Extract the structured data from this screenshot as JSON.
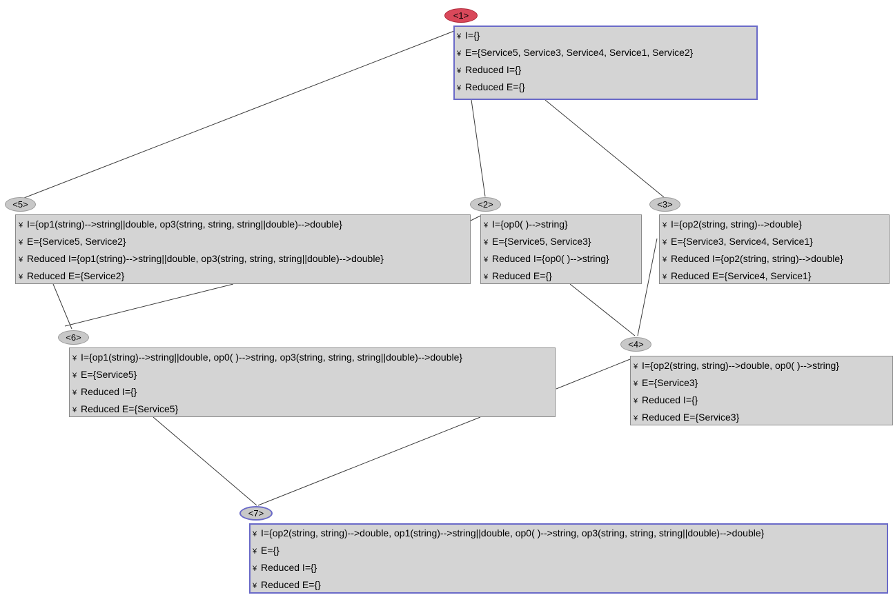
{
  "bullet": "¥",
  "nodes": [
    {
      "id": "1",
      "label": "<1>",
      "rows": [
        "I={}",
        "E={Service5, Service3, Service4, Service1, Service2}",
        "Reduced I={}",
        "Reduced E={}"
      ]
    },
    {
      "id": "2",
      "label": "<2>",
      "rows": [
        "I={op0( )-->string}",
        "E={Service5, Service3}",
        "Reduced I={op0( )-->string}",
        "Reduced E={}"
      ]
    },
    {
      "id": "3",
      "label": "<3>",
      "rows": [
        "I={op2(string, string)-->double}",
        "E={Service3, Service4, Service1}",
        "Reduced I={op2(string, string)-->double}",
        "Reduced E={Service4, Service1}"
      ]
    },
    {
      "id": "4",
      "label": "<4>",
      "rows": [
        "I={op2(string, string)-->double, op0( )-->string}",
        "E={Service3}",
        "Reduced I={}",
        "Reduced E={Service3}"
      ]
    },
    {
      "id": "5",
      "label": "<5>",
      "rows": [
        "I={op1(string)-->string||double, op3(string, string, string||double)-->double}",
        "E={Service5, Service2}",
        "Reduced I={op1(string)-->string||double, op3(string, string, string||double)-->double}",
        "Reduced E={Service2}"
      ]
    },
    {
      "id": "6",
      "label": "<6>",
      "rows": [
        "I={op1(string)-->string||double, op0( )-->string, op3(string, string, string||double)-->double}",
        "E={Service5}",
        "Reduced I={}",
        "Reduced E={Service5}"
      ]
    },
    {
      "id": "7",
      "label": "<7>",
      "rows": [
        "I={op2(string, string)-->double, op1(string)-->string||double, op0( )-->string, op3(string, string, string||double)-->double}",
        "E={}",
        "Reduced I={}",
        "Reduced E={}"
      ]
    }
  ],
  "edges": [
    [
      "1",
      "5"
    ],
    [
      "1",
      "2"
    ],
    [
      "1",
      "3"
    ],
    [
      "5",
      "6"
    ],
    [
      "2",
      "6"
    ],
    [
      "2",
      "4"
    ],
    [
      "3",
      "4"
    ],
    [
      "6",
      "7"
    ],
    [
      "4",
      "7"
    ]
  ]
}
